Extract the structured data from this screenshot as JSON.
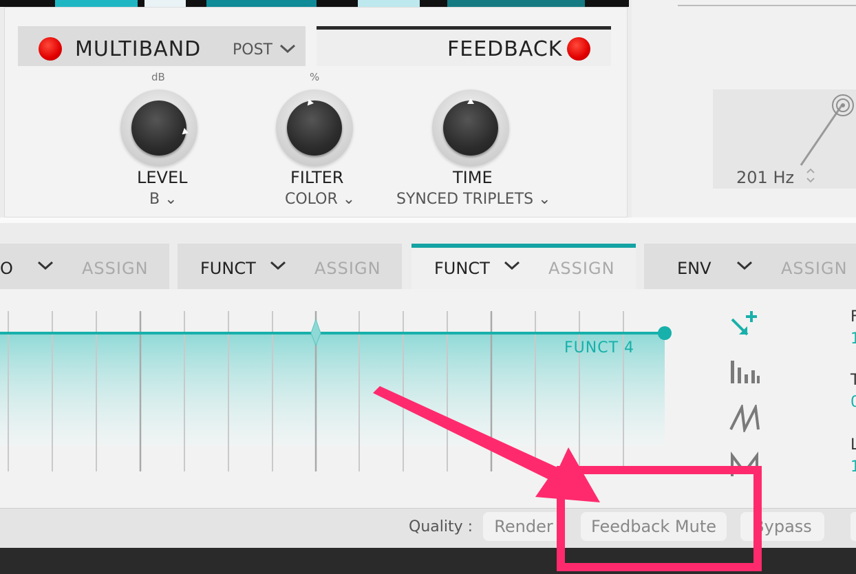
{
  "multiband": {
    "title": "MULTIBAND",
    "mode": "POST",
    "chevron": "⌄"
  },
  "feedback": {
    "title": "FEEDBACK"
  },
  "knobs": [
    {
      "unit": "dB",
      "label": "LEVEL",
      "sub": "B ⌄"
    },
    {
      "unit": "%",
      "label": "FILTER",
      "sub": "COLOR ⌄"
    },
    {
      "unit": "",
      "label": "TIME",
      "sub": "SYNCED TRIPLETS ⌄"
    }
  ],
  "filter": {
    "frequency": "201 Hz",
    "arrows": "⌃\n⌄"
  },
  "tabs": [
    {
      "name": "O",
      "assign": "ASSIGN"
    },
    {
      "name": "FUNCT",
      "assign": "ASSIGN"
    },
    {
      "name": "FUNCT",
      "assign": "ASSIGN"
    },
    {
      "name": "ENV",
      "assign": "ASSIGN"
    }
  ],
  "tab_chevron": "⌄",
  "graph": {
    "label": "FUNCT 4",
    "accent": "#18b0aa"
  },
  "right_cut_letters": [
    "F",
    "1",
    "T",
    "0",
    "L",
    "1"
  ],
  "status": {
    "quality_label": "Quality :",
    "buttons": [
      "Render",
      "Feedback Mute",
      "Bypass"
    ]
  },
  "icons": [
    "add-point-icon",
    "bars-icon",
    "ramp-icon",
    "zigzag-icon"
  ],
  "colors": {
    "led": "#e10000",
    "accent": "#15a3a3",
    "annotation": "#ff2a6d"
  }
}
